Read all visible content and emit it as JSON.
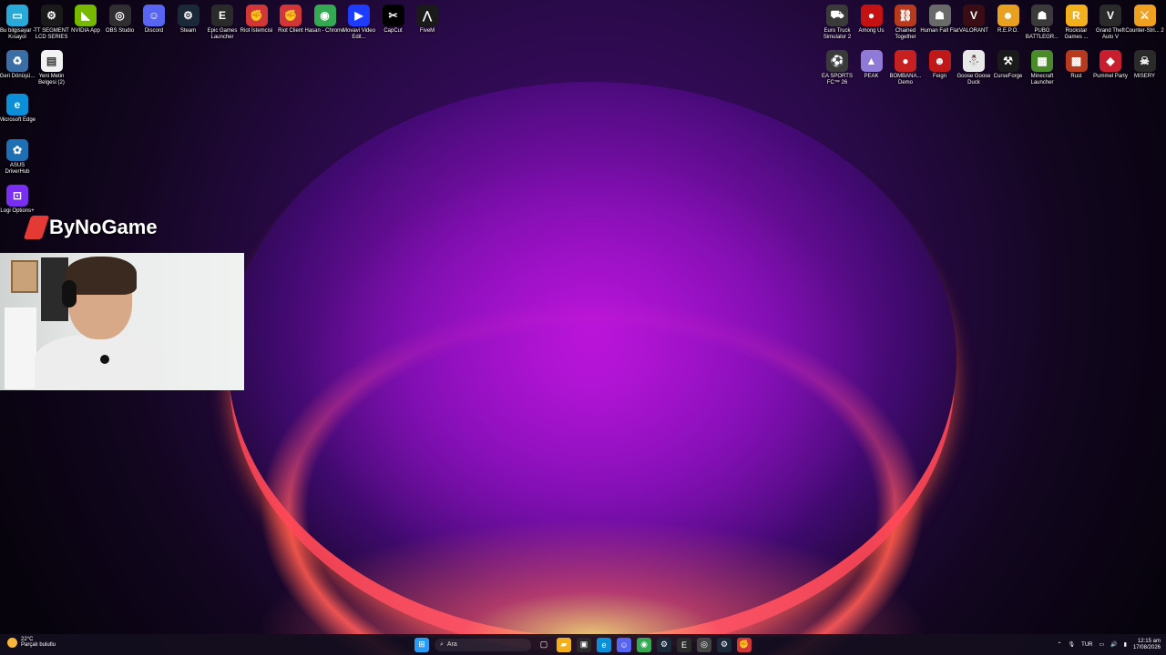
{
  "desktop": {
    "left_top_row": [
      {
        "label": "Bu bilgisayar - Kısayol",
        "color": "#2aa8d8",
        "glyph": "▭"
      },
      {
        "label": "TT SEGMENT LCD SERIES",
        "color": "#1a1a1a",
        "glyph": "⚙"
      },
      {
        "label": "NVIDIA App",
        "color": "#76b900",
        "glyph": "◣"
      },
      {
        "label": "OBS Studio",
        "color": "#302e31",
        "glyph": "◎"
      },
      {
        "label": "Discord",
        "color": "#5865f2",
        "glyph": "☺"
      },
      {
        "label": "Steam",
        "color": "#1b2838",
        "glyph": "⚙"
      },
      {
        "label": "Epic Games Launcher",
        "color": "#2a2a2a",
        "glyph": "E"
      },
      {
        "label": "Riot İstemcisi",
        "color": "#d13639",
        "glyph": "✊"
      },
      {
        "label": "Riot Client",
        "color": "#d13639",
        "glyph": "✊"
      },
      {
        "label": "Hasan - Chrome",
        "color": "#34a853",
        "glyph": "◉"
      },
      {
        "label": "Movavi Video Edit...",
        "color": "#1e3cff",
        "glyph": "▶"
      },
      {
        "label": "CapCut",
        "color": "#000000",
        "glyph": "✂"
      },
      {
        "label": "FiveM",
        "color": "#1a1a1a",
        "glyph": "⋀"
      }
    ],
    "left_column": [
      {
        "label": "Geri Dönüşü...",
        "color": "#3b6ea5",
        "glyph": "♻"
      },
      {
        "label": "Yeni Metin Belgesi (2)",
        "color": "#f2f2f2",
        "glyph": "▤"
      }
    ],
    "left_column_lower": [
      {
        "label": "Microsoft Edge",
        "color": "#0c8fd8",
        "glyph": "e"
      },
      {
        "label": "ASUS DriverHub",
        "color": "#1f6fb5",
        "glyph": "✿"
      },
      {
        "label": "Logi Options+",
        "color": "#7a2ef0",
        "glyph": "⊡"
      }
    ],
    "right_top_row": [
      {
        "label": "Euro Truck Simulator 2",
        "color": "#3a3a3a",
        "glyph": "⛟"
      },
      {
        "label": "Among Us",
        "color": "#c51111",
        "glyph": "●"
      },
      {
        "label": "Chained Together",
        "color": "#b83a1e",
        "glyph": "⛓"
      },
      {
        "label": "Human Fall Flat",
        "color": "#6a6a6a",
        "glyph": "☗"
      },
      {
        "label": "VALORANT",
        "color": "#3a0d14",
        "glyph": "V"
      },
      {
        "label": "R.E.P.O.",
        "color": "#e8a020",
        "glyph": "☻"
      },
      {
        "label": "PUBG BATTLEGR...",
        "color": "#3a3a3a",
        "glyph": "☗"
      },
      {
        "label": "Rockstar Games ...",
        "color": "#f2b01c",
        "glyph": "R"
      },
      {
        "label": "Grand Theft Auto V",
        "color": "#2a2a2a",
        "glyph": "V"
      },
      {
        "label": "Counter-Stri... 2",
        "color": "#f0a020",
        "glyph": "⚔"
      }
    ],
    "right_second_row": [
      {
        "label": "EA SPORTS FC™ 26",
        "color": "#3a3a3a",
        "glyph": "⚽"
      },
      {
        "label": "PEAK",
        "color": "#8f7ad8",
        "glyph": "▲"
      },
      {
        "label": "BOMBANA... Demo",
        "color": "#c62020",
        "glyph": "●"
      },
      {
        "label": "Feign",
        "color": "#c01818",
        "glyph": "☻"
      },
      {
        "label": "Goose Goose Duck",
        "color": "#e8e8e8",
        "glyph": "⛄"
      },
      {
        "label": "CurseForge",
        "color": "#1a1a1a",
        "glyph": "⚒"
      },
      {
        "label": "Minecraft Launcher",
        "color": "#4a8a2a",
        "glyph": "▦"
      },
      {
        "label": "Rust",
        "color": "#b83a1e",
        "glyph": "▩"
      },
      {
        "label": "Pummel Party",
        "color": "#c81e2e",
        "glyph": "◆"
      },
      {
        "label": "MISERY",
        "color": "#2a2a2a",
        "glyph": "☠"
      }
    ]
  },
  "overlay": {
    "brand_text": "ByNoGame"
  },
  "taskbar": {
    "weather_temp": "22°C",
    "weather_desc": "Parçalı bulutlu",
    "search_placeholder": "Ara",
    "language": "TUR",
    "time": "12:15 am",
    "date": "17/08/2026",
    "pinned": [
      {
        "name": "start",
        "glyph": "⊞",
        "color": "#2b9af3"
      },
      {
        "name": "search",
        "glyph": "⌕",
        "color": "transparent"
      },
      {
        "name": "task-view",
        "glyph": "▢",
        "color": "transparent"
      },
      {
        "name": "file-explorer",
        "glyph": "▰",
        "color": "#f2b01c"
      },
      {
        "name": "store",
        "glyph": "▣",
        "color": "#2a2a2a"
      },
      {
        "name": "edge",
        "glyph": "e",
        "color": "#0c8fd8"
      },
      {
        "name": "discord",
        "glyph": "☺",
        "color": "#5865f2"
      },
      {
        "name": "chrome",
        "glyph": "◉",
        "color": "#34a853"
      },
      {
        "name": "steam",
        "glyph": "⚙",
        "color": "#1b2838"
      },
      {
        "name": "epic",
        "glyph": "E",
        "color": "#2a2a2a"
      },
      {
        "name": "chrome-2",
        "glyph": "◎",
        "color": "#444"
      },
      {
        "name": "steam-2",
        "glyph": "⚙",
        "color": "#1b2838"
      },
      {
        "name": "riot",
        "glyph": "✊",
        "color": "#d13639"
      }
    ]
  }
}
